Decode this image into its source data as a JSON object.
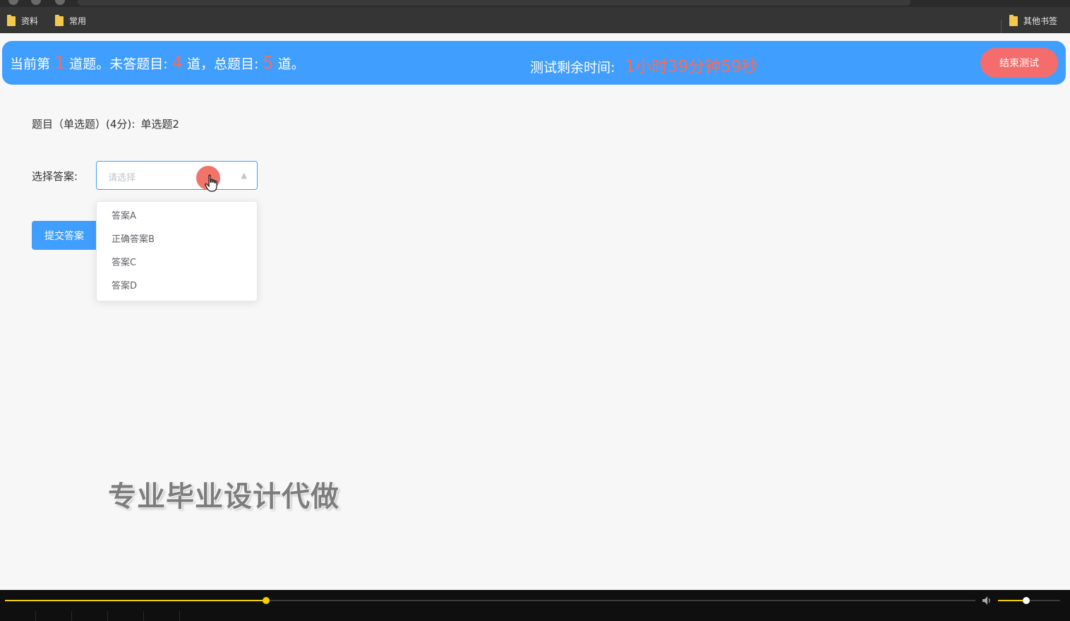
{
  "browser": {
    "bookmarks": [
      {
        "label": "资料"
      },
      {
        "label": "常用"
      }
    ],
    "other_bookmarks": "其他书签"
  },
  "header": {
    "progress_prefix": "当前第",
    "current": "1",
    "progress_mid1": "道题。未答题目:",
    "unanswered": "4",
    "progress_mid2": "道，总题目:",
    "total": "5",
    "progress_suffix": "道。",
    "timer_label": "测试剩余时间:",
    "timer_value": "1小时39分钟59秒",
    "end_button": "结束测试"
  },
  "question": {
    "label": "题目（单选题）(4分):",
    "text": "单选题2"
  },
  "answer": {
    "label": "选择答案:",
    "placeholder": "请选择",
    "options": [
      "答案A",
      "正确答案B",
      "答案C",
      "答案D"
    ]
  },
  "submit_button": "提交答案",
  "watermark": "专业毕业设计代做",
  "player": {
    "progress_fraction": 0.269,
    "volume_fraction": 0.45
  },
  "colors": {
    "primary": "#409eff",
    "highlight": "#ff6a52",
    "danger": "#f56c6c",
    "player_accent": "#f5d000"
  }
}
